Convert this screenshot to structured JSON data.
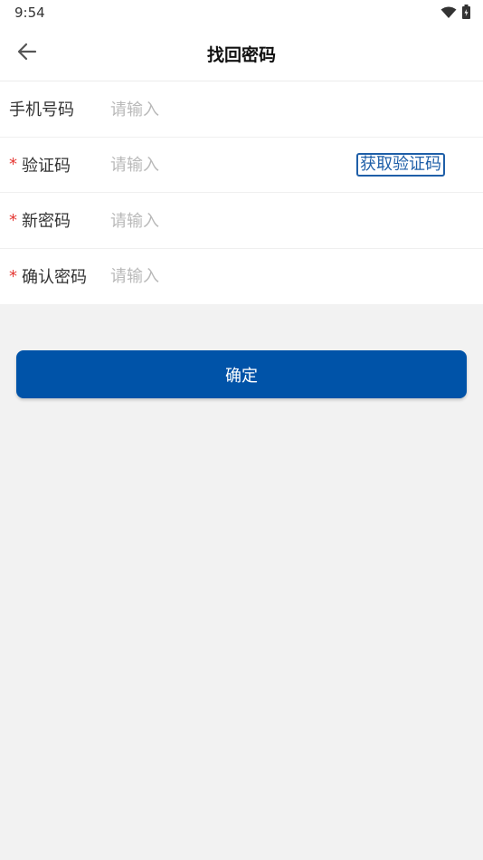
{
  "status_bar": {
    "time": "9:54"
  },
  "header": {
    "title": "找回密码"
  },
  "form": {
    "phone": {
      "label": "手机号码",
      "placeholder": "请输入",
      "required": false
    },
    "code": {
      "label": "验证码",
      "placeholder": "请输入",
      "required": true,
      "get_code_label": "获取验证码"
    },
    "new_password": {
      "label": "新密码",
      "placeholder": "请输入",
      "required": true
    },
    "confirm_password": {
      "label": "确认密码",
      "placeholder": "请输入",
      "required": true
    },
    "required_mark": "*"
  },
  "confirm_button": {
    "label": "确定"
  },
  "colors": {
    "primary": "#0053a8",
    "link": "#1f5fa8",
    "required": "#e53935",
    "background": "#f2f2f2"
  }
}
